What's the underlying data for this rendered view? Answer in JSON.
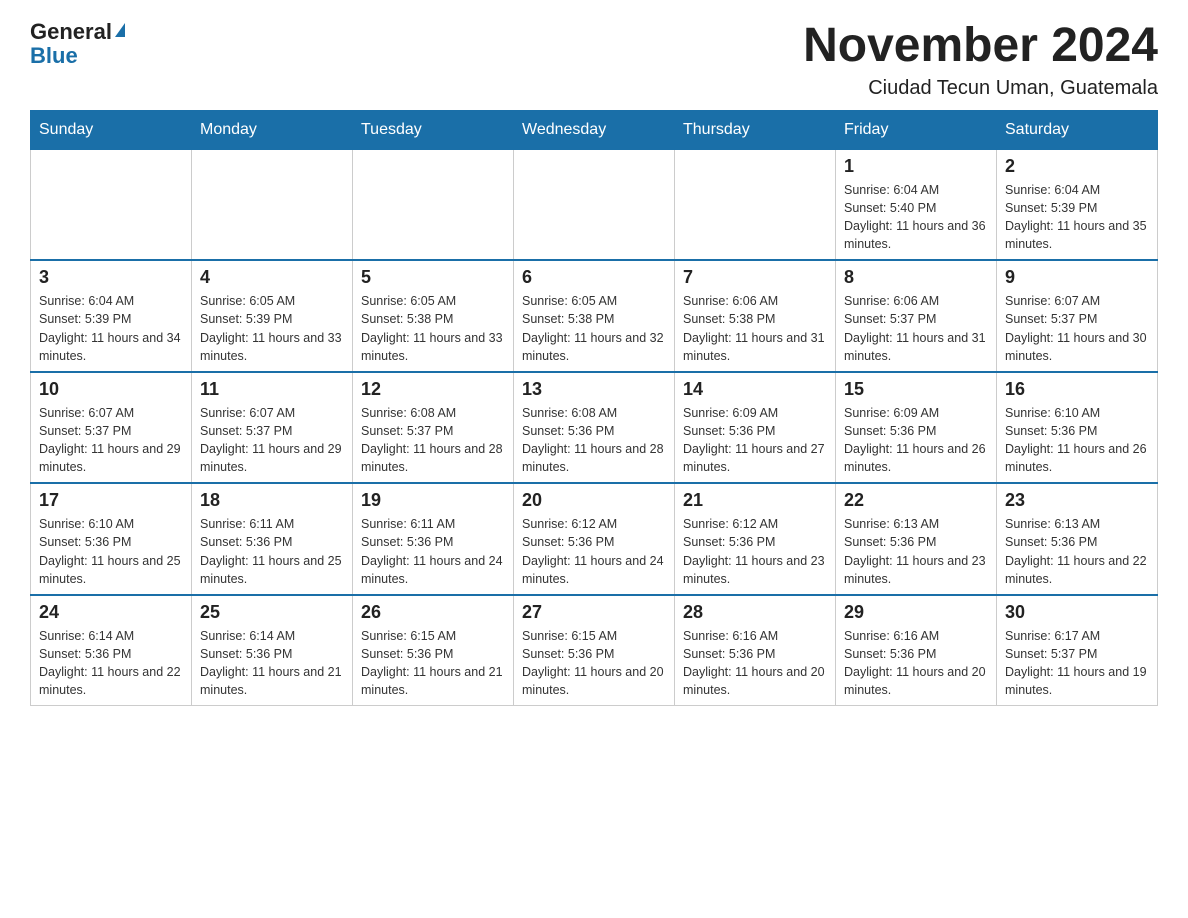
{
  "logo": {
    "general": "General",
    "blue": "Blue"
  },
  "header": {
    "month_year": "November 2024",
    "location": "Ciudad Tecun Uman, Guatemala"
  },
  "days_of_week": [
    "Sunday",
    "Monday",
    "Tuesday",
    "Wednesday",
    "Thursday",
    "Friday",
    "Saturday"
  ],
  "weeks": [
    [
      {
        "day": "",
        "info": ""
      },
      {
        "day": "",
        "info": ""
      },
      {
        "day": "",
        "info": ""
      },
      {
        "day": "",
        "info": ""
      },
      {
        "day": "",
        "info": ""
      },
      {
        "day": "1",
        "info": "Sunrise: 6:04 AM\nSunset: 5:40 PM\nDaylight: 11 hours and 36 minutes."
      },
      {
        "day": "2",
        "info": "Sunrise: 6:04 AM\nSunset: 5:39 PM\nDaylight: 11 hours and 35 minutes."
      }
    ],
    [
      {
        "day": "3",
        "info": "Sunrise: 6:04 AM\nSunset: 5:39 PM\nDaylight: 11 hours and 34 minutes."
      },
      {
        "day": "4",
        "info": "Sunrise: 6:05 AM\nSunset: 5:39 PM\nDaylight: 11 hours and 33 minutes."
      },
      {
        "day": "5",
        "info": "Sunrise: 6:05 AM\nSunset: 5:38 PM\nDaylight: 11 hours and 33 minutes."
      },
      {
        "day": "6",
        "info": "Sunrise: 6:05 AM\nSunset: 5:38 PM\nDaylight: 11 hours and 32 minutes."
      },
      {
        "day": "7",
        "info": "Sunrise: 6:06 AM\nSunset: 5:38 PM\nDaylight: 11 hours and 31 minutes."
      },
      {
        "day": "8",
        "info": "Sunrise: 6:06 AM\nSunset: 5:37 PM\nDaylight: 11 hours and 31 minutes."
      },
      {
        "day": "9",
        "info": "Sunrise: 6:07 AM\nSunset: 5:37 PM\nDaylight: 11 hours and 30 minutes."
      }
    ],
    [
      {
        "day": "10",
        "info": "Sunrise: 6:07 AM\nSunset: 5:37 PM\nDaylight: 11 hours and 29 minutes."
      },
      {
        "day": "11",
        "info": "Sunrise: 6:07 AM\nSunset: 5:37 PM\nDaylight: 11 hours and 29 minutes."
      },
      {
        "day": "12",
        "info": "Sunrise: 6:08 AM\nSunset: 5:37 PM\nDaylight: 11 hours and 28 minutes."
      },
      {
        "day": "13",
        "info": "Sunrise: 6:08 AM\nSunset: 5:36 PM\nDaylight: 11 hours and 28 minutes."
      },
      {
        "day": "14",
        "info": "Sunrise: 6:09 AM\nSunset: 5:36 PM\nDaylight: 11 hours and 27 minutes."
      },
      {
        "day": "15",
        "info": "Sunrise: 6:09 AM\nSunset: 5:36 PM\nDaylight: 11 hours and 26 minutes."
      },
      {
        "day": "16",
        "info": "Sunrise: 6:10 AM\nSunset: 5:36 PM\nDaylight: 11 hours and 26 minutes."
      }
    ],
    [
      {
        "day": "17",
        "info": "Sunrise: 6:10 AM\nSunset: 5:36 PM\nDaylight: 11 hours and 25 minutes."
      },
      {
        "day": "18",
        "info": "Sunrise: 6:11 AM\nSunset: 5:36 PM\nDaylight: 11 hours and 25 minutes."
      },
      {
        "day": "19",
        "info": "Sunrise: 6:11 AM\nSunset: 5:36 PM\nDaylight: 11 hours and 24 minutes."
      },
      {
        "day": "20",
        "info": "Sunrise: 6:12 AM\nSunset: 5:36 PM\nDaylight: 11 hours and 24 minutes."
      },
      {
        "day": "21",
        "info": "Sunrise: 6:12 AM\nSunset: 5:36 PM\nDaylight: 11 hours and 23 minutes."
      },
      {
        "day": "22",
        "info": "Sunrise: 6:13 AM\nSunset: 5:36 PM\nDaylight: 11 hours and 23 minutes."
      },
      {
        "day": "23",
        "info": "Sunrise: 6:13 AM\nSunset: 5:36 PM\nDaylight: 11 hours and 22 minutes."
      }
    ],
    [
      {
        "day": "24",
        "info": "Sunrise: 6:14 AM\nSunset: 5:36 PM\nDaylight: 11 hours and 22 minutes."
      },
      {
        "day": "25",
        "info": "Sunrise: 6:14 AM\nSunset: 5:36 PM\nDaylight: 11 hours and 21 minutes."
      },
      {
        "day": "26",
        "info": "Sunrise: 6:15 AM\nSunset: 5:36 PM\nDaylight: 11 hours and 21 minutes."
      },
      {
        "day": "27",
        "info": "Sunrise: 6:15 AM\nSunset: 5:36 PM\nDaylight: 11 hours and 20 minutes."
      },
      {
        "day": "28",
        "info": "Sunrise: 6:16 AM\nSunset: 5:36 PM\nDaylight: 11 hours and 20 minutes."
      },
      {
        "day": "29",
        "info": "Sunrise: 6:16 AM\nSunset: 5:36 PM\nDaylight: 11 hours and 20 minutes."
      },
      {
        "day": "30",
        "info": "Sunrise: 6:17 AM\nSunset: 5:37 PM\nDaylight: 11 hours and 19 minutes."
      }
    ]
  ]
}
